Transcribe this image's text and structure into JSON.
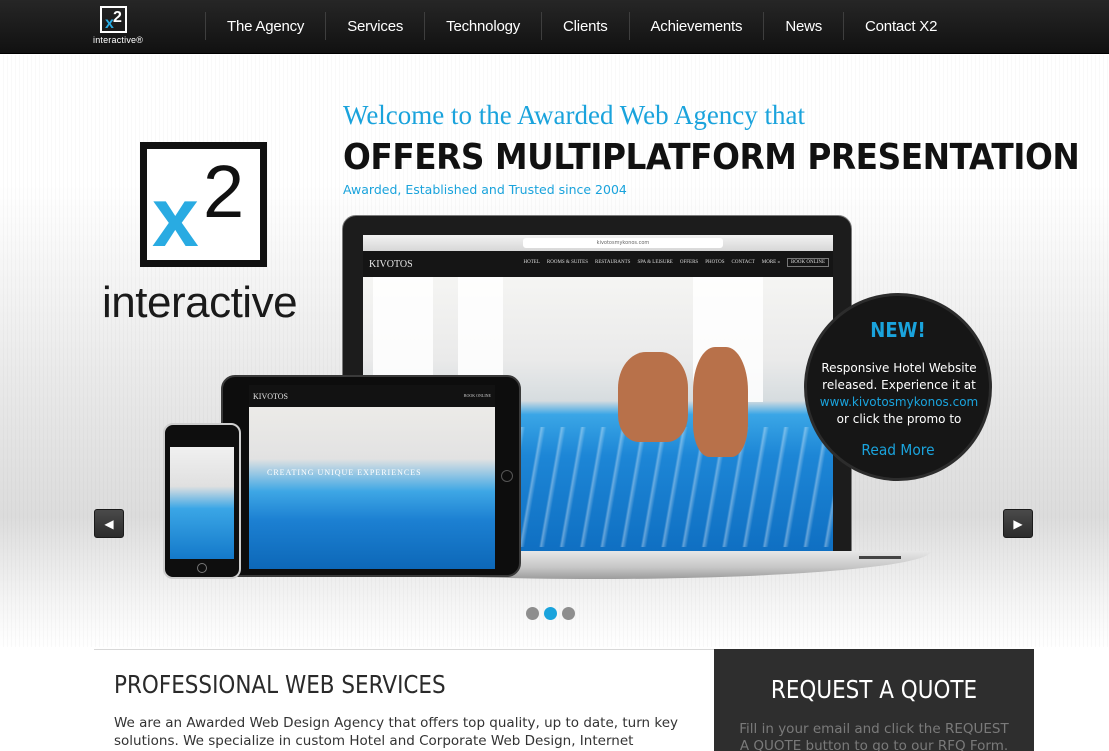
{
  "brand": {
    "logo_mark": "x2",
    "logo_word": "interactive",
    "logo_word_small": "interactive®"
  },
  "nav": {
    "items": [
      "The Agency",
      "Services",
      "Technology",
      "Clients",
      "Achievements",
      "News",
      "Contact X2"
    ]
  },
  "hero": {
    "welcome": "Welcome to the Awarded Web Agency that",
    "headline": "OFFERS MULTIPLATFORM PRESENTATION",
    "tagline": "Awarded, Established and Trusted since 2004",
    "mock_site": {
      "url": "kivotosmykonos.com",
      "brand": "KIVOTOS",
      "menu": [
        "HOTEL",
        "ROOMS & SUITES",
        "RESTAURANTS",
        "SPA & LEISURE",
        "OFFERS",
        "PHOTOS",
        "CONTACT",
        "MORE »"
      ],
      "book": "BOOK ONLINE",
      "tablet_overlay": "CREATING UNIQUE EXPERIENCES"
    },
    "promo": {
      "badge": "NEW!",
      "line1": "Responsive Hotel Website released. Experience it at",
      "link": "www.kivotosmykonos.com",
      "line2": "or click the promo to",
      "cta": "Read More"
    },
    "prev_icon": "arrow-left-icon",
    "next_icon": "arrow-right-icon",
    "slides": {
      "count": 3,
      "active": 2
    }
  },
  "services": {
    "title": "PROFESSIONAL WEB SERVICES",
    "body": "We are an Awarded Web Design Agency that offers top quality, up to date, turn key solutions. We specialize in custom Hotel and Corporate Web Design, Internet Marketing,"
  },
  "quote": {
    "title": "REQUEST A QUOTE",
    "body": "Fill in your email and click the REQUEST A QUOTE button to go to our RFQ Form."
  },
  "colors": {
    "accent": "#1aa3dc",
    "nav_bg": "#1a1a1a",
    "panel_bg": "#2e2e2e"
  }
}
